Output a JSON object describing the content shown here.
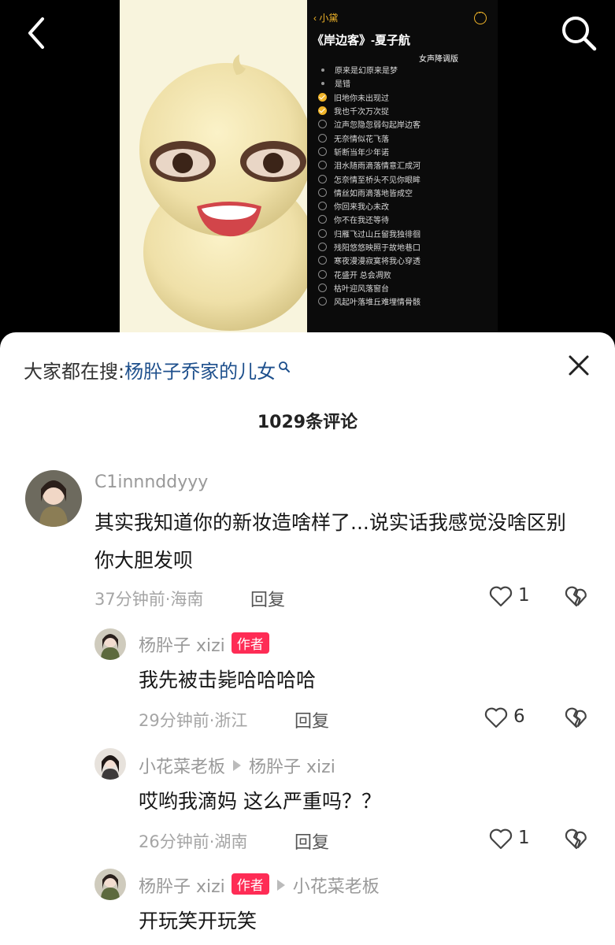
{
  "video": {
    "lyrics_back": "小黛",
    "lyrics_title": "《岸边客》-夏子航",
    "lyrics_subtitle": "女声降调版",
    "lyrics": [
      {
        "text": "原来是幻原来是梦",
        "mark": "dot"
      },
      {
        "text": "是错",
        "mark": "dot"
      },
      {
        "text": "旧地你未出现过",
        "mark": "check"
      },
      {
        "text": "我也千次万次捉",
        "mark": "check"
      },
      {
        "text": "泣声忽隐忽弱勾起岸边客",
        "mark": "empty"
      },
      {
        "text": "无奈情似花飞落",
        "mark": "empty"
      },
      {
        "text": "斩断当年少年诺",
        "mark": "empty"
      },
      {
        "text": "泪水随雨滴落情意汇成河",
        "mark": "empty"
      },
      {
        "text": "怎奈情至桥头不见你眼眸",
        "mark": "empty"
      },
      {
        "text": "情丝如雨滴落地皆成空",
        "mark": "empty"
      },
      {
        "text": "你回来我心未改",
        "mark": "empty"
      },
      {
        "text": "你不在我还等待",
        "mark": "empty"
      },
      {
        "text": "归雁飞过山丘留我独徘徊",
        "mark": "empty"
      },
      {
        "text": "残阳悠悠映照于故地巷口",
        "mark": "empty"
      },
      {
        "text": "寒夜漫漫寂寞将我心穿透",
        "mark": "empty"
      },
      {
        "text": "花盛开 总会凋败",
        "mark": "empty"
      },
      {
        "text": "枯叶迎风落窗台",
        "mark": "empty"
      },
      {
        "text": "风起叶落堆丘难埋情骨骸",
        "mark": "empty"
      }
    ]
  },
  "sheet": {
    "suggest_prefix": "大家都在搜:",
    "suggest_query": "杨肸子乔家的儿女",
    "comment_count": "1029条评论"
  },
  "comments": [
    {
      "user": "C1innnddyyy",
      "text": "其实我知道你的新妆造啥样了...说实话我感觉没啥区别 你大胆发呗",
      "meta": "37分钟前·海南",
      "reply_label": "回复",
      "likes": "1"
    }
  ],
  "replies": [
    {
      "user": "杨肸子 xizi",
      "badge": "作者",
      "reply_to": "",
      "text": "我先被击毙哈哈哈哈",
      "meta": "29分钟前·浙江",
      "reply_label": "回复",
      "likes": "6"
    },
    {
      "user": "小花菜老板",
      "badge": "",
      "reply_to": "杨肸子 xizi",
      "text": "哎哟我滴妈 这么严重吗？？",
      "meta": "26分钟前·湖南",
      "reply_label": "回复",
      "likes": "1"
    },
    {
      "user": "杨肸子 xizi",
      "badge": "作者",
      "reply_to": "小花菜老板",
      "text": "开玩笑开玩笑",
      "meta": "",
      "reply_label": "",
      "likes": ""
    }
  ],
  "colors": {
    "accent": "#fe2c55",
    "link": "#1d4f8c",
    "lyrics_highlight": "#f0b429"
  }
}
